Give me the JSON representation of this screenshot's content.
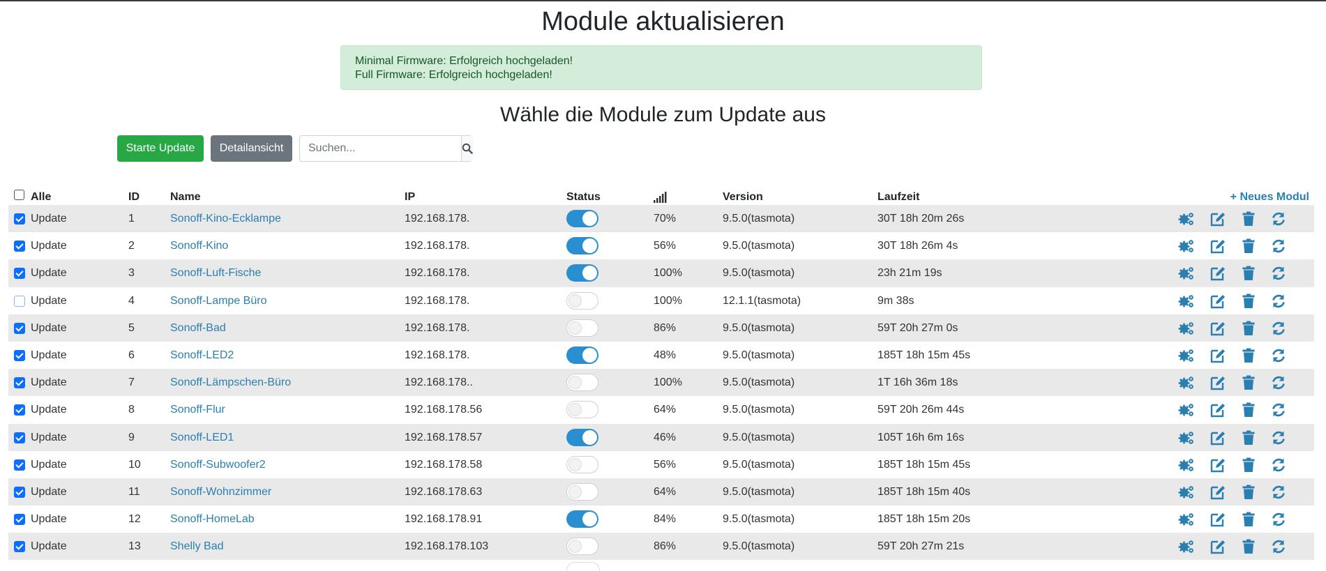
{
  "page": {
    "title": "Module aktualisieren",
    "alert_lines": [
      "Minimal Firmware: Erfolgreich hochgeladen!",
      "Full Firmware: Erfolgreich hochgeladen!"
    ],
    "subtitle": "Wähle die Module zum Update aus"
  },
  "toolbar": {
    "start_label": "Starte Update",
    "detail_label": "Detailansicht",
    "search_placeholder": "Suchen...",
    "search_value": ""
  },
  "table": {
    "headers": {
      "all": "Alle",
      "id": "ID",
      "name": "Name",
      "ip": "IP",
      "status": "Status",
      "signal_icon": "signal-bars-icon",
      "version": "Version",
      "uptime": "Laufzeit",
      "new_module": "Neues Modul"
    },
    "row_check_label": "Update",
    "all_checked": false,
    "rows": [
      {
        "checked": true,
        "id": "1",
        "name": "Sonoff-Kino-Ecklampe",
        "ip": "192.168.178.",
        "status": true,
        "signal": "70%",
        "version": "9.5.0(tasmota)",
        "uptime": "30T 18h 20m 26s"
      },
      {
        "checked": true,
        "id": "2",
        "name": "Sonoff-Kino",
        "ip": "192.168.178.",
        "status": true,
        "signal": "56%",
        "version": "9.5.0(tasmota)",
        "uptime": "30T 18h 26m 4s"
      },
      {
        "checked": true,
        "id": "3",
        "name": "Sonoff-Luft-Fische",
        "ip": "192.168.178.",
        "status": true,
        "signal": "100%",
        "version": "9.5.0(tasmota)",
        "uptime": "23h 21m 19s"
      },
      {
        "checked": false,
        "id": "4",
        "name": "Sonoff-Lampe Büro",
        "ip": "192.168.178.",
        "status": false,
        "signal": "100%",
        "version": "12.1.1(tasmota)",
        "uptime": "9m 38s"
      },
      {
        "checked": true,
        "id": "5",
        "name": "Sonoff-Bad",
        "ip": "192.168.178.",
        "status": false,
        "signal": "86%",
        "version": "9.5.0(tasmota)",
        "uptime": "59T 20h 27m 0s"
      },
      {
        "checked": true,
        "id": "6",
        "name": "Sonoff-LED2",
        "ip": "192.168.178.",
        "status": true,
        "signal": "48%",
        "version": "9.5.0(tasmota)",
        "uptime": "185T 18h 15m 45s"
      },
      {
        "checked": true,
        "id": "7",
        "name": "Sonoff-Lämpschen-Büro",
        "ip": "192.168.178..",
        "status": false,
        "signal": "100%",
        "version": "9.5.0(tasmota)",
        "uptime": "1T 16h 36m 18s"
      },
      {
        "checked": true,
        "id": "8",
        "name": "Sonoff-Flur",
        "ip": "192.168.178.56",
        "status": false,
        "signal": "64%",
        "version": "9.5.0(tasmota)",
        "uptime": "59T 20h 26m 44s"
      },
      {
        "checked": true,
        "id": "9",
        "name": "Sonoff-LED1",
        "ip": "192.168.178.57",
        "status": true,
        "signal": "46%",
        "version": "9.5.0(tasmota)",
        "uptime": "105T 16h 6m 16s"
      },
      {
        "checked": true,
        "id": "10",
        "name": "Sonoff-Subwoofer2",
        "ip": "192.168.178.58",
        "status": false,
        "signal": "56%",
        "version": "9.5.0(tasmota)",
        "uptime": "185T 18h 15m 45s"
      },
      {
        "checked": true,
        "id": "11",
        "name": "Sonoff-Wohnzimmer",
        "ip": "192.168.178.63",
        "status": false,
        "signal": "64%",
        "version": "9.5.0(tasmota)",
        "uptime": "185T 18h 15m 40s"
      },
      {
        "checked": true,
        "id": "12",
        "name": "Sonoff-HomeLab",
        "ip": "192.168.178.91",
        "status": true,
        "signal": "84%",
        "version": "9.5.0(tasmota)",
        "uptime": "185T 18h 15m 20s"
      },
      {
        "checked": true,
        "id": "13",
        "name": "Shelly Bad",
        "ip": "192.168.178.103",
        "status": false,
        "signal": "86%",
        "version": "9.5.0(tasmota)",
        "uptime": "59T 20h 27m 21s"
      }
    ],
    "row_actions": [
      "gears-icon",
      "edit-icon",
      "trash-icon",
      "sync-icon"
    ]
  },
  "colors": {
    "accent": "#2a7fb0",
    "toggle_on": "#2a8fd0",
    "success": "#28a745",
    "secondary": "#6c757d",
    "alert_bg": "#d4edda",
    "row_stripe": "#e9e9e9"
  }
}
